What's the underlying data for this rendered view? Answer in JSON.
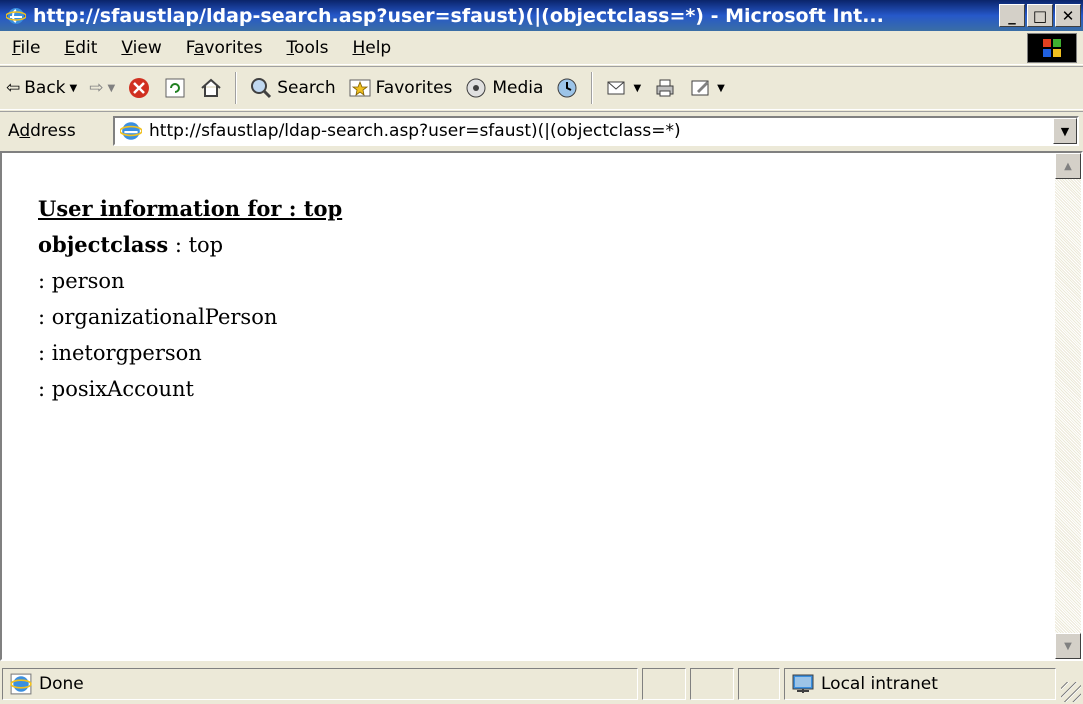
{
  "window": {
    "title": "http://sfaustlap/ldap-search.asp?user=sfaust)(|(objectclass=*) - Microsoft Int...",
    "icon": "ie-icon",
    "controls": [
      "minimize",
      "maximize",
      "close"
    ]
  },
  "menubar": {
    "items": [
      {
        "accel": "F",
        "rest": "ile"
      },
      {
        "accel": "E",
        "rest": "dit"
      },
      {
        "accel": "V",
        "rest": "iew"
      },
      {
        "pre": "F",
        "accel": "a",
        "rest": "vorites"
      },
      {
        "accel": "T",
        "rest": "ools"
      },
      {
        "accel": "H",
        "rest": "elp"
      }
    ]
  },
  "toolbar": {
    "back_label": "Back",
    "search_label": "Search",
    "favorites_label": "Favorites",
    "media_label": "Media"
  },
  "address": {
    "label_pre": "A",
    "label_accel": "d",
    "label_rest": "dress",
    "url": "http://sfaustlap/ldap-search.asp?user=sfaust)(|(objectclass=*)"
  },
  "page": {
    "heading": "User information for : top",
    "attribute_name": "objectclass",
    "first_value": " : top",
    "values": [
      ": person",
      ": organizationalPerson",
      ": inetorgperson",
      ": posixAccount"
    ]
  },
  "status": {
    "text": "Done",
    "zone": "Local intranet"
  },
  "colors": {
    "titlebar": "#0a246a",
    "chrome": "#ece9d8",
    "content_bg": "#ffffff"
  }
}
